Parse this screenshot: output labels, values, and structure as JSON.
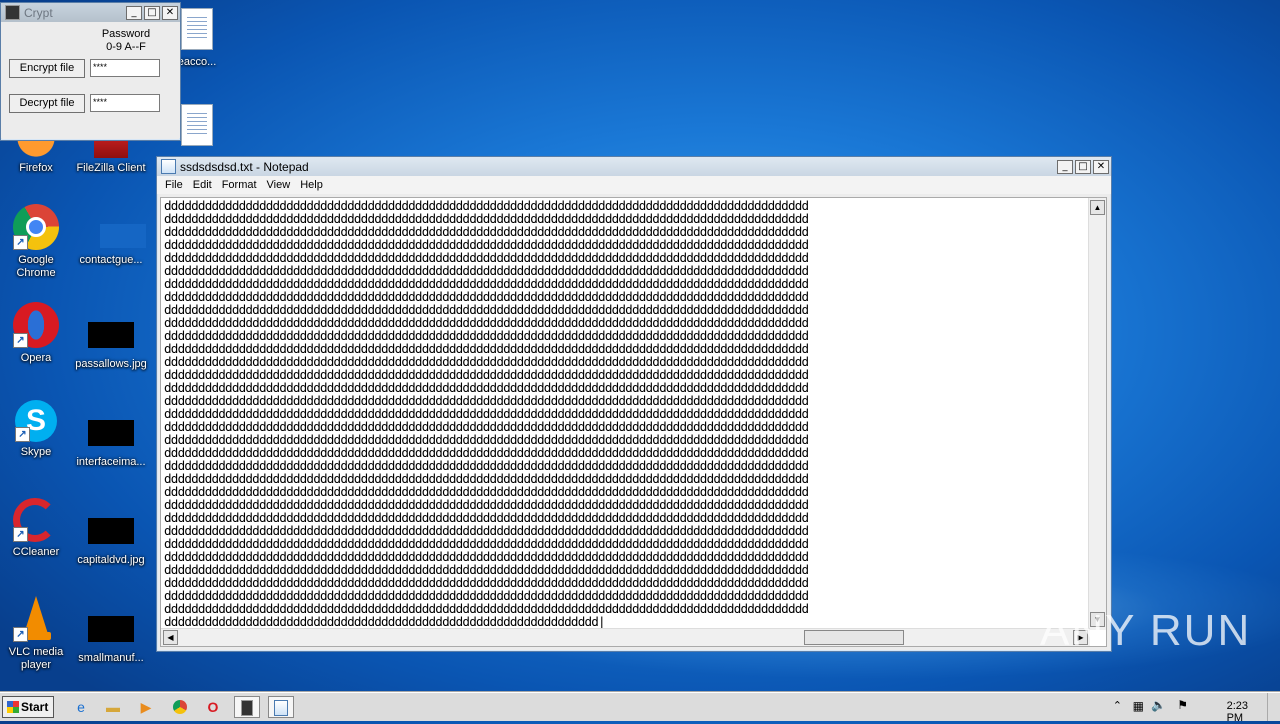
{
  "crypt_window": {
    "title": "Crypt",
    "password_label": "Password",
    "password_hint": "0-9 A--F",
    "encrypt_button": "Encrypt file",
    "decrypt_button": "Decrypt file",
    "encrypt_password_value": "****",
    "decrypt_password_value": "****"
  },
  "notepad": {
    "title": "ssdsdsdsd.txt - Notepad",
    "menu": [
      "File",
      "Edit",
      "Format",
      "View",
      "Help"
    ],
    "content_char": "d",
    "full_lines": 32,
    "chars_per_line": 95,
    "last_line_chars": 64
  },
  "desktop_icons": {
    "firefox": "Firefox",
    "filezilla": "FileZilla Client",
    "chrome": "Google Chrome",
    "contactgue": "contactgue...",
    "opera": "Opera",
    "passallows": "passallows.jpg",
    "skype": "Skype",
    "interfaceima": "interfaceima...",
    "ccleaner": "CCleaner",
    "capitaldvd": "capitaldvd.jpg",
    "vlc": "VLC media player",
    "smallmanuf": "smallmanuf...",
    "eacco": "eacco..."
  },
  "taskbar": {
    "start_label": "Start",
    "clock": "2:23 PM"
  },
  "watermark": "ANY RUN",
  "colors": {
    "desktop_blue": "#1a78d6",
    "crypt_title_inactive": "#6d7681"
  }
}
